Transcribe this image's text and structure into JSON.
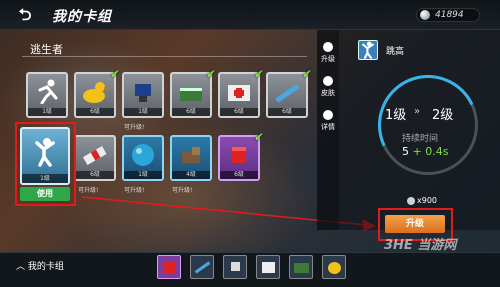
{
  "header": {
    "back_icon": "back-arrow-icon",
    "title": "我的卡组",
    "currency": "41894"
  },
  "category": {
    "label": "逃生者"
  },
  "cards_row1": [
    {
      "level": "1级",
      "icon": "runner-icon",
      "color": "gray",
      "checked": false
    },
    {
      "level": "6级",
      "icon": "duck-icon",
      "color": "gray",
      "checked": true
    },
    {
      "level": "1级",
      "icon": "flag-icon",
      "color": "gray",
      "checked": false
    },
    {
      "level": "6级",
      "icon": "crate-icon",
      "color": "gray",
      "checked": true
    },
    {
      "level": "6级",
      "icon": "medkit-icon",
      "color": "gray",
      "checked": true
    },
    {
      "level": "6级",
      "icon": "gun-icon",
      "color": "gray",
      "checked": true
    }
  ],
  "cards_row2": [
    {
      "level": "6级",
      "icon": "bandage-icon",
      "color": "gray",
      "checked": false
    },
    {
      "level": "1级",
      "icon": "bubble-icon",
      "color": "blue",
      "checked": false
    },
    {
      "level": "4级",
      "icon": "dog-icon",
      "color": "blue",
      "checked": false
    },
    {
      "level": "6级",
      "icon": "red-cube-icon",
      "color": "purple",
      "checked": true
    }
  ],
  "upgradable_label": "可升级!",
  "selected_card": {
    "level": "1级",
    "icon": "jumping-man-icon",
    "use_label": "使用"
  },
  "tabs": [
    {
      "label": "升级",
      "icon": "upgrade-icon"
    },
    {
      "label": "皮肤",
      "icon": "skin-icon"
    },
    {
      "label": "详情",
      "icon": "info-icon"
    }
  ],
  "skill": {
    "name": "跳高",
    "level_from": "1级",
    "level_arrow": "»",
    "level_to": "2级",
    "stat_label": "持续时间",
    "stat_value": "5",
    "stat_bonus": "+ 0.4s",
    "cost": "x900",
    "upgrade_label": "升级"
  },
  "bottom": {
    "label": "我的卡组"
  },
  "watermark": "3HE 当游网",
  "colors": {
    "accent_blue": "#39b4e8",
    "upgrade_orange": "#e8852c",
    "use_green": "#2fa84a",
    "highlight_red": "#e21b1b"
  }
}
